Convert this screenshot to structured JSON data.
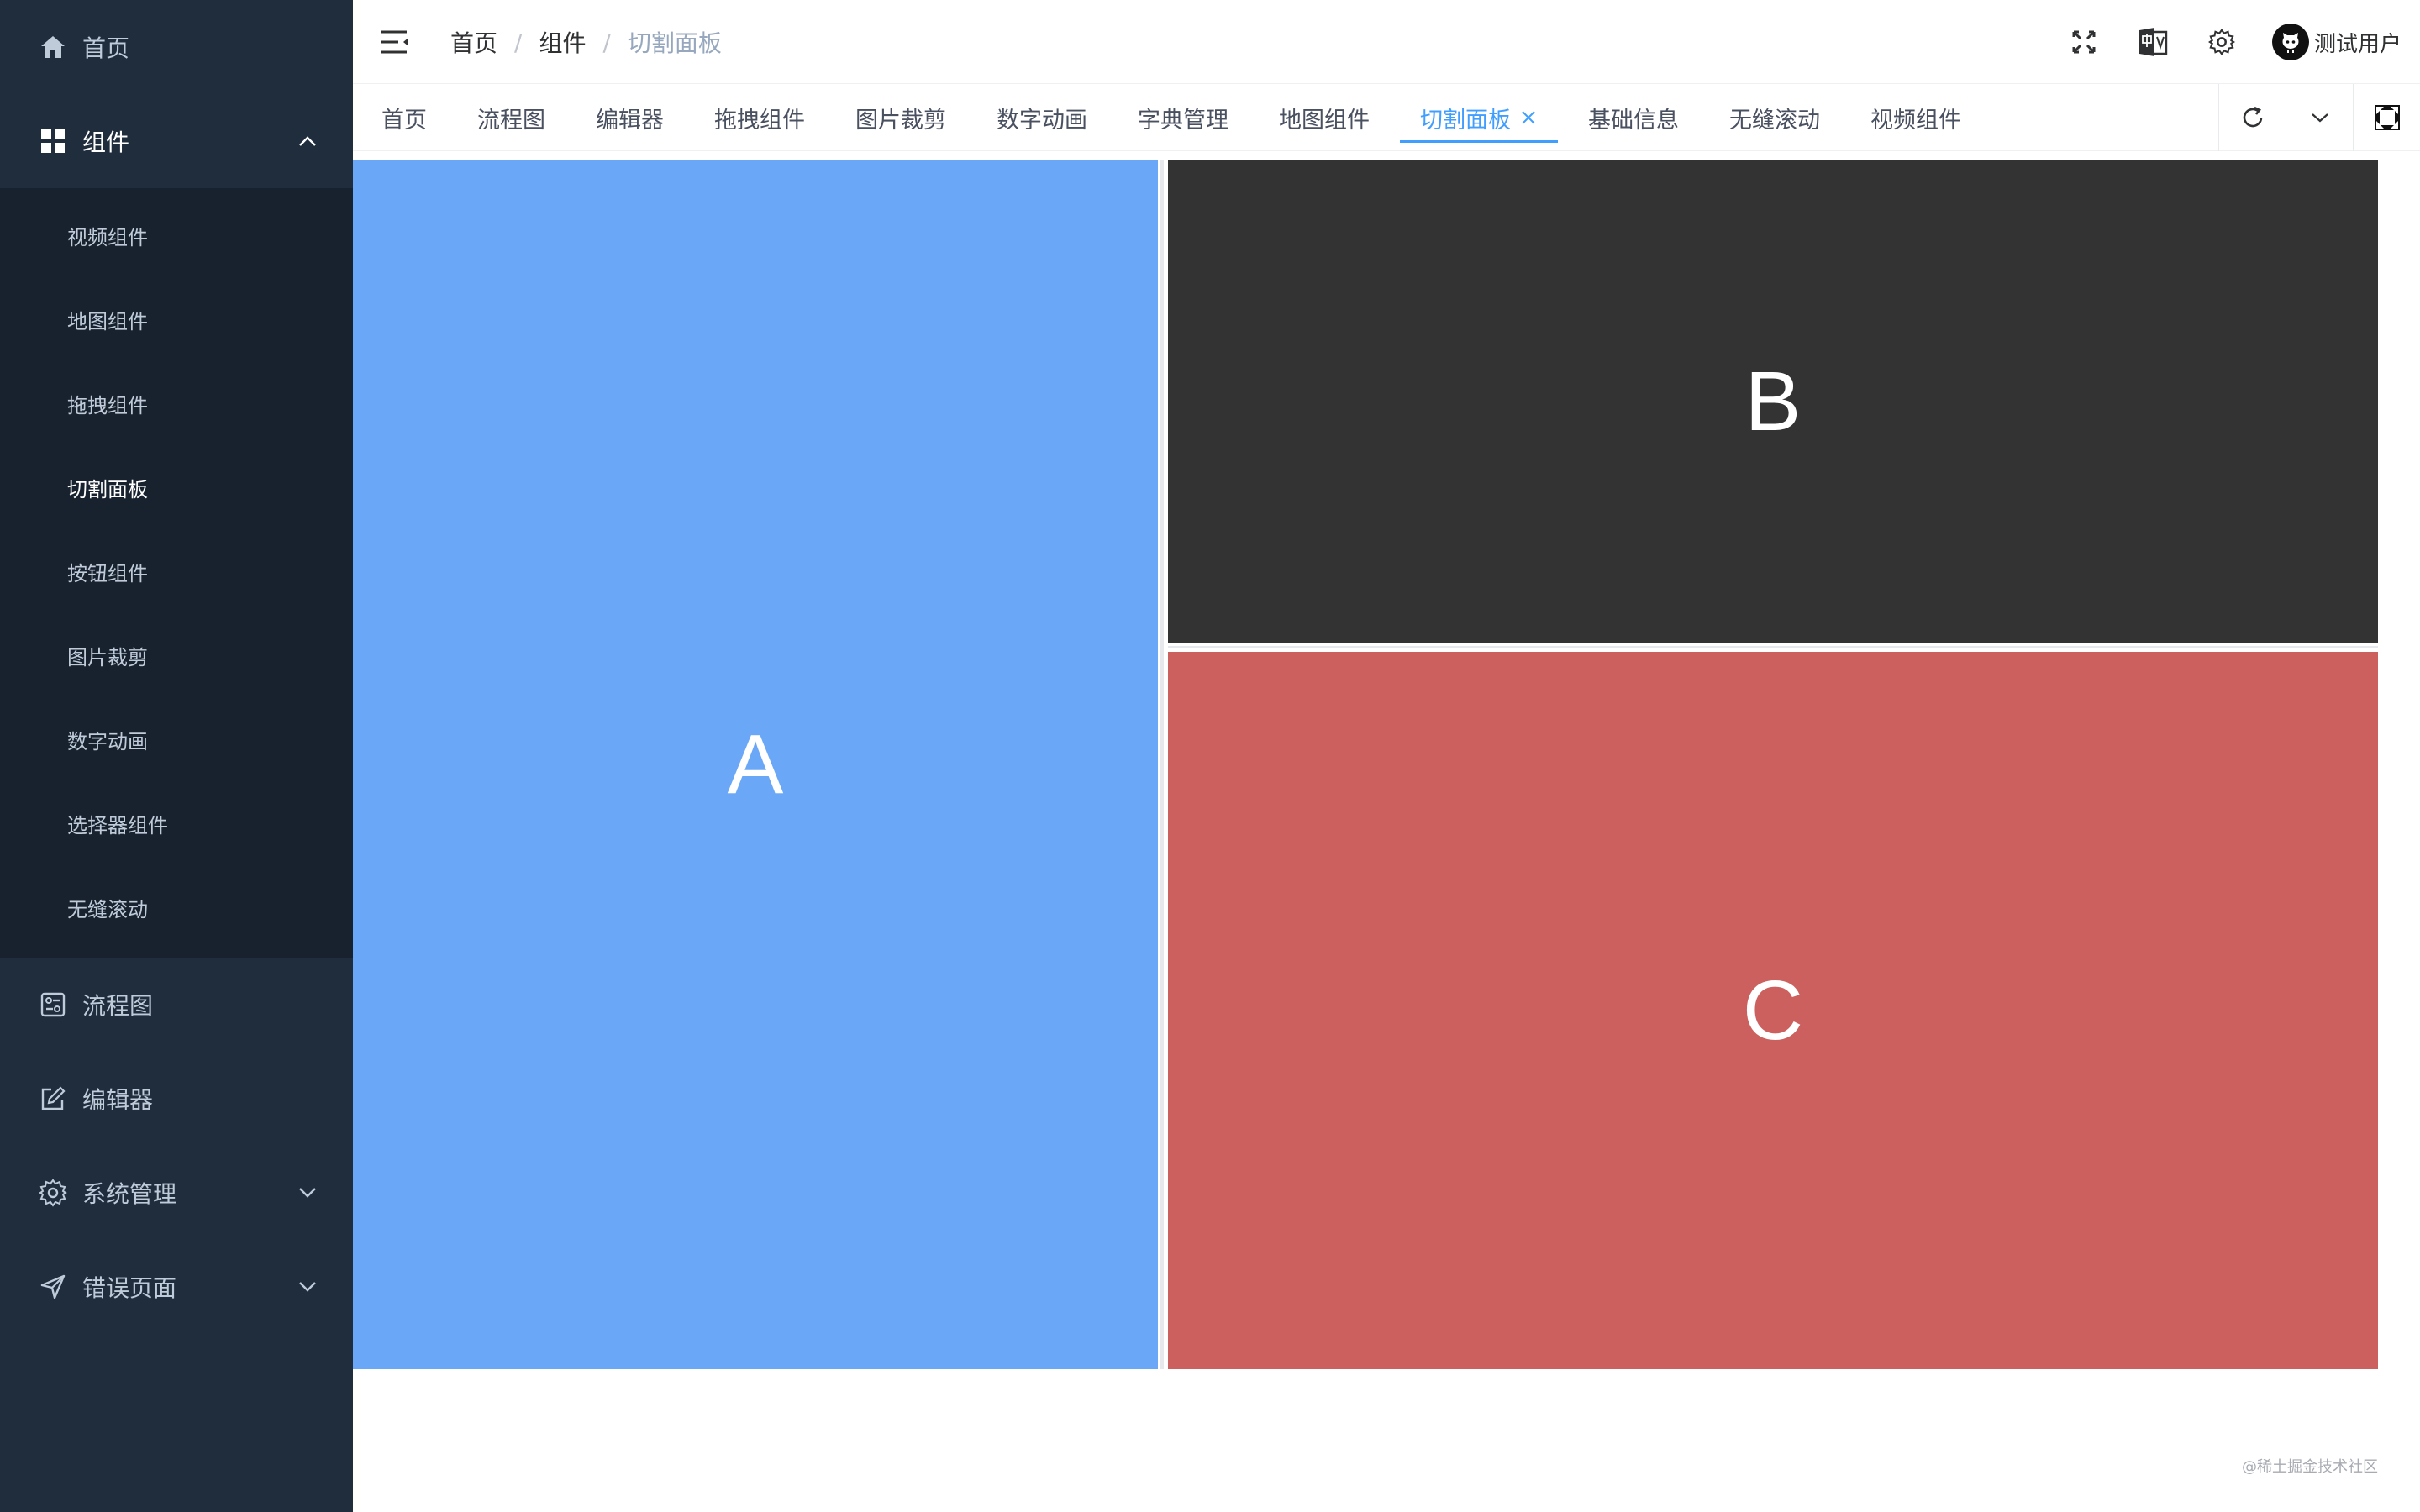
{
  "sidebar": {
    "menu": [
      {
        "label": "首页",
        "icon": "home-icon"
      },
      {
        "label": "组件",
        "icon": "grid-icon",
        "children": [
          "视频组件",
          "地图组件",
          "拖拽组件",
          "切割面板",
          "按钮组件",
          "图片裁剪",
          "数字动画",
          "选择器组件",
          "无缝滚动"
        ],
        "active_child": "切割面板"
      },
      {
        "label": "流程图",
        "icon": "flowchart-icon"
      },
      {
        "label": "编辑器",
        "icon": "edit-icon"
      },
      {
        "label": "系统管理",
        "icon": "gear-icon"
      },
      {
        "label": "错误页面",
        "icon": "send-icon"
      }
    ]
  },
  "header": {
    "breadcrumb": [
      "首页",
      "组件",
      "切割面板"
    ],
    "user_name": "测试用户"
  },
  "tags": [
    "首页",
    "流程图",
    "编辑器",
    "拖拽组件",
    "图片裁剪",
    "数字动画",
    "字典管理",
    "地图组件",
    "切割面板",
    "基础信息",
    "无缝滚动",
    "视频组件"
  ],
  "active_tag": "切割面板",
  "panes": {
    "a": "A",
    "b": "B",
    "c": "C"
  },
  "colors": {
    "sidebar_bg": "#1f2d3d",
    "accent": "#409eff",
    "pane_a": "#6aa8f7",
    "pane_b": "#333333",
    "pane_c": "#cc605e"
  },
  "watermark": "@稀土掘金技术社区"
}
